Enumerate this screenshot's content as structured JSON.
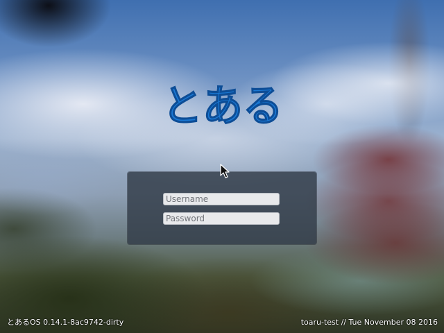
{
  "logo": {
    "text": "とある",
    "color": "#1a78d4"
  },
  "login": {
    "username_placeholder": "Username",
    "password_placeholder": "Password"
  },
  "footer": {
    "os_version": "とあるOS 0.14.1-8ac9742-dirty",
    "host_date": "toaru-test // Tue November 08 2016"
  },
  "icons": {
    "cursor": "mouse-pointer-icon"
  },
  "colors": {
    "panel_background": "#323c48",
    "field_background": "#e8e9eb",
    "footer_text": "#ffffff"
  }
}
